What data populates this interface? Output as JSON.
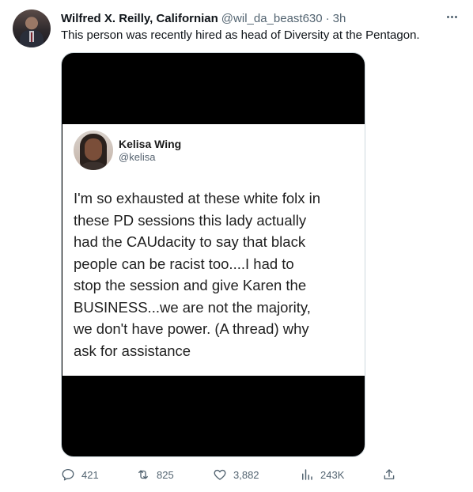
{
  "tweet": {
    "author_name": "Wilfred X. Reilly, Californian",
    "author_handle": "@wil_da_beast630",
    "separator": "·",
    "time": "3h",
    "text": "This person was recently hired as head of Diversity at the Pentagon."
  },
  "quoted": {
    "name": "Kelisa Wing",
    "handle": "@kelisa",
    "lines": [
      "I'm so exhausted at these white folx in",
      "these PD sessions this lady actually",
      "had the CAUdacity to say that black",
      "people can be racist too....I had to",
      "stop the session and give Karen the",
      "BUSINESS...we are not the majority,",
      "we don't have power. (A thread) why",
      "ask for assistance"
    ]
  },
  "actions": {
    "replies": "421",
    "retweets": "825",
    "likes": "3,882",
    "views": "243K"
  },
  "icons": {
    "more": "more-icon",
    "reply": "reply-icon",
    "retweet": "retweet-icon",
    "like": "heart-icon",
    "views": "views-icon",
    "share": "share-icon"
  },
  "colors": {
    "text": "#0f1419",
    "secondary": "#536471",
    "border": "#cfd9de",
    "media_background": "#000000"
  }
}
